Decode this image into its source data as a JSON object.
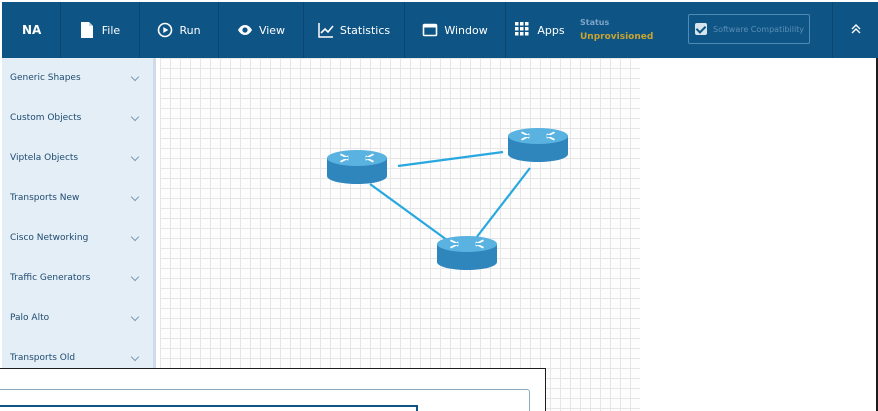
{
  "header": {
    "brand": "NA",
    "menu": [
      {
        "label": "File",
        "icon": "file-icon"
      },
      {
        "label": "Run",
        "icon": "play-icon"
      },
      {
        "label": "View",
        "icon": "eye-icon"
      },
      {
        "label": "Statistics",
        "icon": "chart-icon"
      },
      {
        "label": "Window",
        "icon": "window-icon"
      },
      {
        "label": "Apps",
        "icon": "apps-grid-icon"
      }
    ],
    "status_label": "Status",
    "status_value": "Unprovisioned",
    "compat_label": "Software Compatibility",
    "compat_checked": true,
    "colors": {
      "navbar": "#0e5484",
      "status_value": "#c9a430",
      "link_line": "#29a8e0",
      "router": "#3a8fc4"
    }
  },
  "sidebar": {
    "items": [
      {
        "label": "Generic Shapes"
      },
      {
        "label": "Custom Objects"
      },
      {
        "label": "Viptela Objects"
      },
      {
        "label": "Transports New"
      },
      {
        "label": "Cisco Networking"
      },
      {
        "label": "Traffic Generators"
      },
      {
        "label": "Palo Alto"
      },
      {
        "label": "Transports Old"
      }
    ]
  },
  "canvas": {
    "nodes": [
      {
        "name": "router-left",
        "icon": "router-icon"
      },
      {
        "name": "router-right",
        "icon": "router-icon"
      },
      {
        "name": "router-bottom",
        "icon": "router-icon"
      }
    ]
  }
}
